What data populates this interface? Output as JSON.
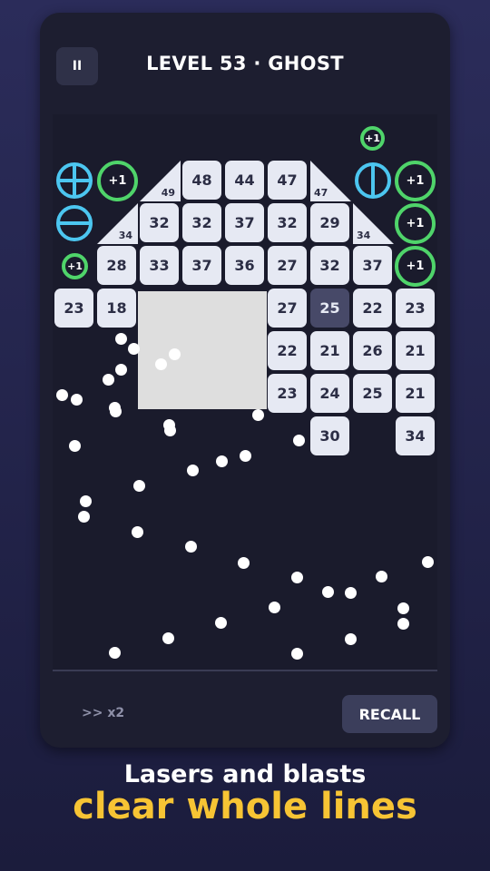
{
  "header": {
    "pause_icon": "pause-icon",
    "pause_glyph": "II",
    "title": "LEVEL 53 · GHOST"
  },
  "grid": {
    "tiles": [
      "48",
      "44",
      "47",
      "32",
      "32",
      "37",
      "32",
      "29",
      "28",
      "33",
      "37",
      "36",
      "27",
      "32",
      "37",
      "23",
      "18",
      "27",
      "25",
      "22",
      "23",
      "22",
      "21",
      "26",
      "21",
      "23",
      "24",
      "25",
      "21",
      "30",
      "34"
    ],
    "triangles": [
      "49",
      "47",
      "34",
      "34"
    ],
    "bonus_label": "+1"
  },
  "footer": {
    "speed_label": ">> x2",
    "recall_label": "RECALL"
  },
  "caption": {
    "line1": "Lasers and blasts",
    "line2": "clear whole lines"
  },
  "colors": {
    "bonus_ring": "#4fd46a",
    "laser": "#4cc6f0",
    "highlight_tile": "#474968",
    "caption_accent": "#f7c434"
  }
}
